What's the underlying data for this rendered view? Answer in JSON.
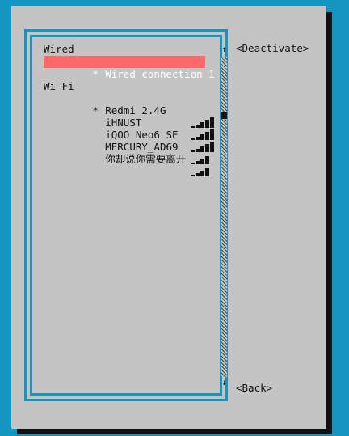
{
  "list": {
    "wired_header": "Wired",
    "wired_items": [
      {
        "marker": "*",
        "name": "Wired connection 1",
        "selected": true
      }
    ],
    "wifi_header": "Wi-Fi",
    "wifi_items": [
      {
        "marker": "*",
        "name": "Redmi_2.4G",
        "signal_bars": 5
      },
      {
        "marker": "",
        "name": "iHNUST",
        "signal_bars": 5
      },
      {
        "marker": "",
        "name": "iQOO Neo6 SE",
        "signal_bars": 5
      },
      {
        "marker": "",
        "name": "MERCURY_AD69",
        "signal_bars": 4
      },
      {
        "marker": "",
        "name": "你却说你需要离开",
        "signal_bars": 4
      }
    ]
  },
  "scrollbar": {
    "up_arrow": "↑",
    "down_arrow": "↓"
  },
  "buttons": {
    "deactivate": "<Deactivate>",
    "back": "<Back>"
  },
  "colors": {
    "background": "#1596c1",
    "dialog": "#c4c4c4",
    "selection": "#ff6868"
  }
}
